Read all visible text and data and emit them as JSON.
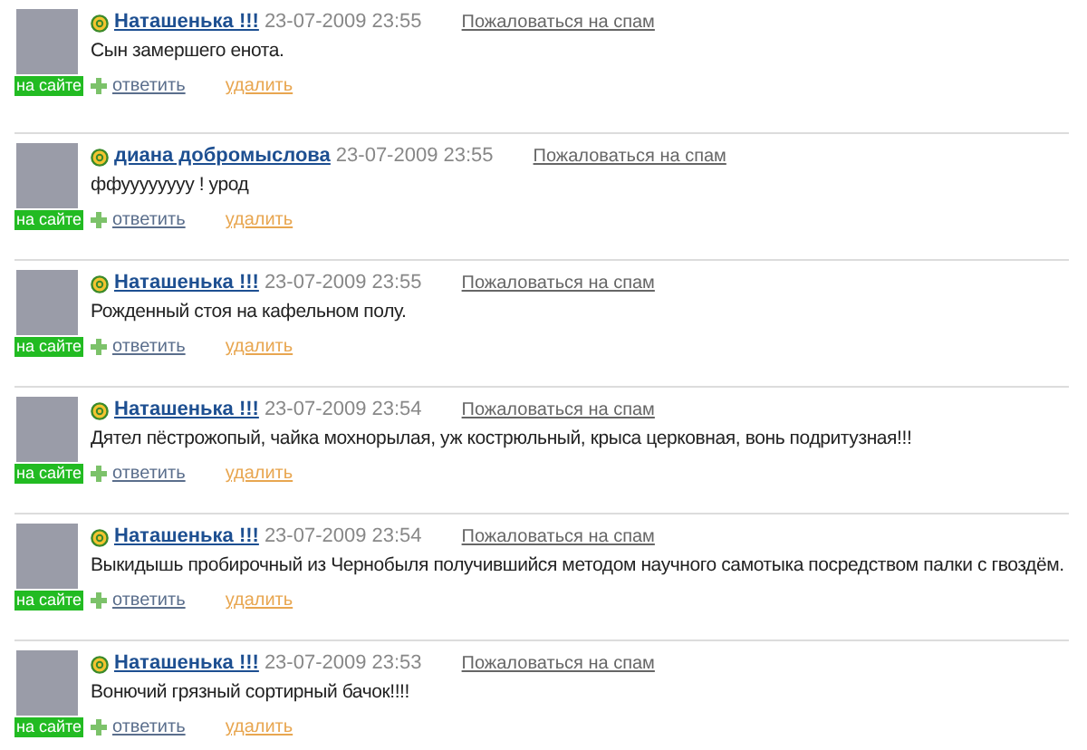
{
  "comments": [
    {
      "author": "Наташенька !!!",
      "time": "23-07-2009 23:55",
      "spam_link": "Пожаловаться на спам",
      "text": "Сын замершего енота.",
      "online_badge": "на сайте",
      "reply": "ответить",
      "delete": "удалить"
    },
    {
      "author": "диана добромыслова",
      "time": "23-07-2009 23:55",
      "spam_link": "Пожаловаться на спам",
      "text": "ффуууууууу ! урод",
      "online_badge": "на сайте",
      "reply": "ответить",
      "delete": "удалить"
    },
    {
      "author": "Наташенька !!!",
      "time": "23-07-2009 23:55",
      "spam_link": "Пожаловаться на спам",
      "text": "Рожденный стоя на кафельном полу.",
      "online_badge": "на сайте",
      "reply": "ответить",
      "delete": "удалить"
    },
    {
      "author": "Наташенька !!!",
      "time": "23-07-2009 23:54",
      "spam_link": "Пожаловаться на спам",
      "text": "Дятел пёстрожопый, чайка мохнорылая, уж кострюльный, крыса церковная, вонь подритузная!!!",
      "online_badge": "на сайте",
      "reply": "ответить",
      "delete": "удалить"
    },
    {
      "author": "Наташенька !!!",
      "time": "23-07-2009 23:54",
      "spam_link": "Пожаловаться на спам",
      "text": "Выкидышь пробирочный из Чернобыля получившийся методом научного самотыка посредством палки с гвоздём.",
      "online_badge": "на сайте",
      "reply": "ответить",
      "delete": "удалить"
    },
    {
      "author": "Наташенька !!!",
      "time": "23-07-2009 23:53",
      "spam_link": "Пожаловаться на спам",
      "text": "Вонючий грязный сортирный бачок!!!!",
      "online_badge": "на сайте",
      "reply": "ответить",
      "delete": "удалить"
    }
  ]
}
